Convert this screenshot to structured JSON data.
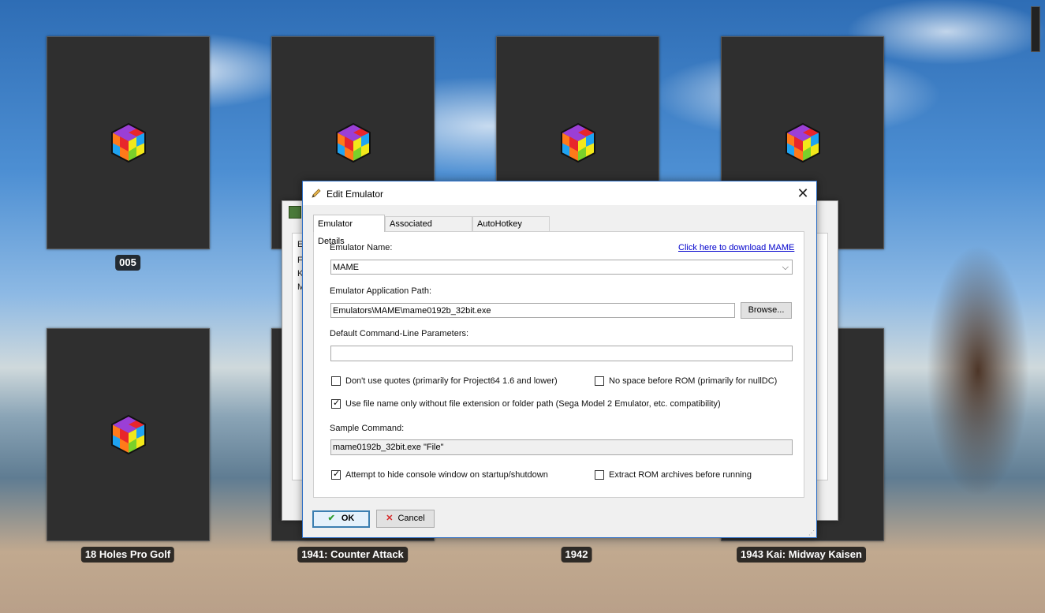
{
  "games": [
    {
      "title": "005"
    },
    {
      "title": ""
    },
    {
      "title": ""
    },
    {
      "title": ""
    },
    {
      "title": "18 Holes Pro Golf"
    },
    {
      "title": "1941: Counter Attack"
    },
    {
      "title": "1942"
    },
    {
      "title": "1943 Kai: Midway Kaisen"
    }
  ],
  "background_window": {
    "fragments": [
      "E",
      "F",
      "K",
      "M"
    ]
  },
  "dialog": {
    "title": "Edit Emulator",
    "close_label": "✕",
    "tabs": [
      {
        "label": "Emulator Details",
        "active": true
      },
      {
        "label": "Associated Platforms",
        "active": false
      },
      {
        "label": "AutoHotkey Script",
        "active": false
      }
    ],
    "emulator_name_label": "Emulator Name:",
    "download_link": "Click here to download MAME",
    "emulator_name_value": "MAME",
    "app_path_label": "Emulator Application Path:",
    "app_path_value": "Emulators\\MAME\\mame0192b_32bit.exe",
    "browse_label": "Browse...",
    "cmdline_label": "Default Command-Line Parameters:",
    "cmdline_value": "",
    "checkboxes": {
      "no_quotes": {
        "label": "Don't use quotes (primarily for Project64 1.6 and lower)",
        "checked": false
      },
      "no_space": {
        "label": "No space before ROM (primarily for nullDC)",
        "checked": false
      },
      "filename_only": {
        "label": "Use file name only without file extension or folder path (Sega Model 2 Emulator, etc. compatibility)",
        "checked": true
      },
      "hide_console": {
        "label": "Attempt to hide console window on startup/shutdown",
        "checked": true
      },
      "extract_rom": {
        "label": "Extract ROM archives before running",
        "checked": false
      }
    },
    "sample_command_label": "Sample Command:",
    "sample_command_value": "mame0192b_32bit.exe \"File\"",
    "ok_label": "OK",
    "cancel_label": "Cancel",
    "ok_color": "#2e9c2e",
    "cancel_color": "#d62828"
  }
}
